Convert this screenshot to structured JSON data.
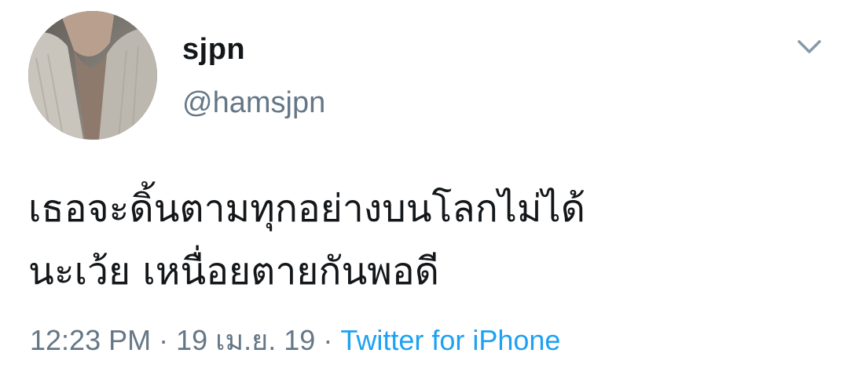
{
  "tweet": {
    "author": {
      "display_name": "sjpn",
      "handle": "@hamsjpn",
      "avatar_icon": "profile-photo"
    },
    "menu_icon": "chevron-down-icon",
    "text": "เธอจะดิ้นตามทุกอย่างบนโลกไม่ได้\nนะเว้ย เหนื่อยตายกันพอดี",
    "time": "12:23 PM",
    "date": "19 เม.ย. 19",
    "separator": "·",
    "source": "Twitter for iPhone"
  },
  "colors": {
    "text_primary": "#14171a",
    "text_secondary": "#657786",
    "link": "#1da1f2",
    "chevron": "#8899a6"
  }
}
